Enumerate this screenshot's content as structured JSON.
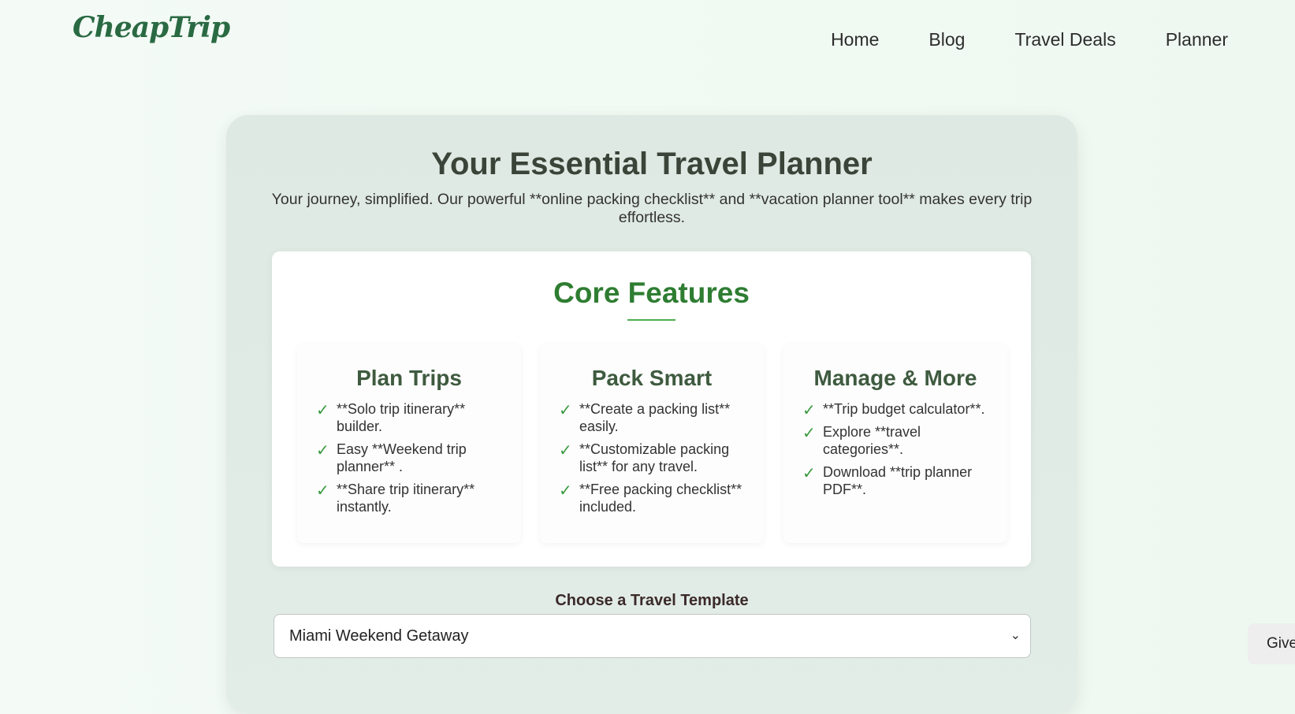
{
  "header": {
    "logo": "CheapTrip",
    "nav": [
      "Home",
      "Blog",
      "Travel Deals",
      "Planner"
    ]
  },
  "hero": {
    "title": "Your Essential Travel Planner",
    "subtitle": "Your journey, simplified. Our powerful **online packing checklist** and **vacation planner tool** makes every trip effortless."
  },
  "features": {
    "title": "Core Features",
    "columns": [
      {
        "heading": "Plan Trips",
        "items": [
          "**Solo trip itinerary** builder.",
          "Easy **Weekend trip planner** .",
          "**Share trip itinerary** instantly."
        ]
      },
      {
        "heading": "Pack Smart",
        "items": [
          "**Create a packing list** easily.",
          "**Customizable packing list** for any travel.",
          "**Free packing checklist** included."
        ]
      },
      {
        "heading": "Manage & More",
        "items": [
          "**Trip budget calculator**.",
          "Explore **travel categories**.",
          "Download **trip planner PDF**."
        ]
      }
    ],
    "check_glyph": "✓"
  },
  "template": {
    "label": "Choose a Travel Template",
    "selected": "Miami Weekend Getaway"
  },
  "feedback_button": "Give",
  "colors": {
    "brand_green": "#2e7d32",
    "logo_green": "#2a6a43",
    "check_green": "#3a9a3f"
  }
}
